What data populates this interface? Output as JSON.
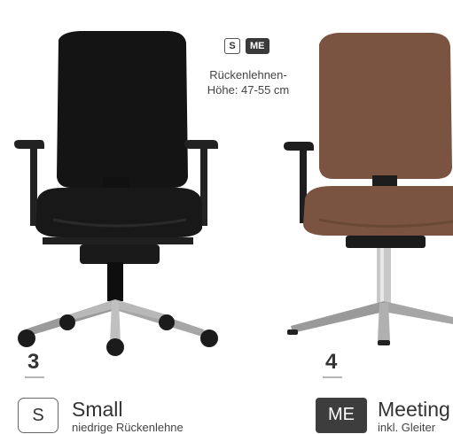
{
  "top_badges": {
    "s": "S",
    "me": "ME"
  },
  "height_info": {
    "line1": "Rückenlehnen-",
    "line2": "Höhe: 47-55 cm"
  },
  "products": [
    {
      "number": "3",
      "code": "S",
      "title": "Small",
      "subtitle": "niedrige Rückenlehne"
    },
    {
      "number": "4",
      "code": "ME",
      "title": "Meeting",
      "subtitle": "inkl. Gleiter"
    }
  ]
}
